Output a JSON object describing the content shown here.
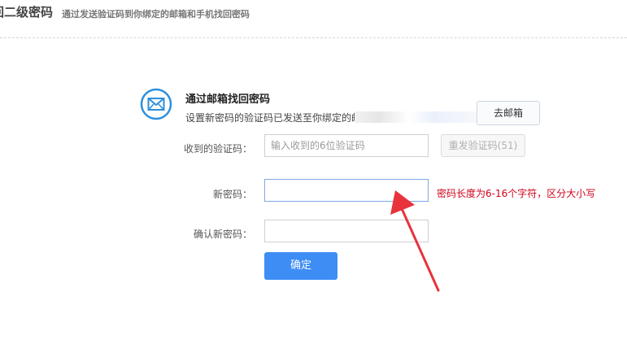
{
  "header": {
    "title": "回二级密码",
    "subtitle": "通过发送验证码到你绑定的邮箱和手机找回密码"
  },
  "section": {
    "icon": "mail-icon",
    "title": "通过邮箱找回密码",
    "description": "设置新密码的验证码已发送至你绑定的邮",
    "go_mail_label": "去邮箱"
  },
  "form": {
    "code_label": "收到的验证码：",
    "code_placeholder": "输入收到的6位验证码",
    "code_value": "",
    "resend_label": "重发验证码(51)",
    "new_password_label": "新密码：",
    "new_password_value": "",
    "confirm_password_label": "确认新密码：",
    "confirm_password_value": "",
    "password_hint": "密码长度为6-16个字符，区分大小写",
    "submit_label": "确定"
  },
  "colors": {
    "primary": "#3d8df5",
    "error": "#d0021b",
    "arrow": "#e8323c"
  }
}
